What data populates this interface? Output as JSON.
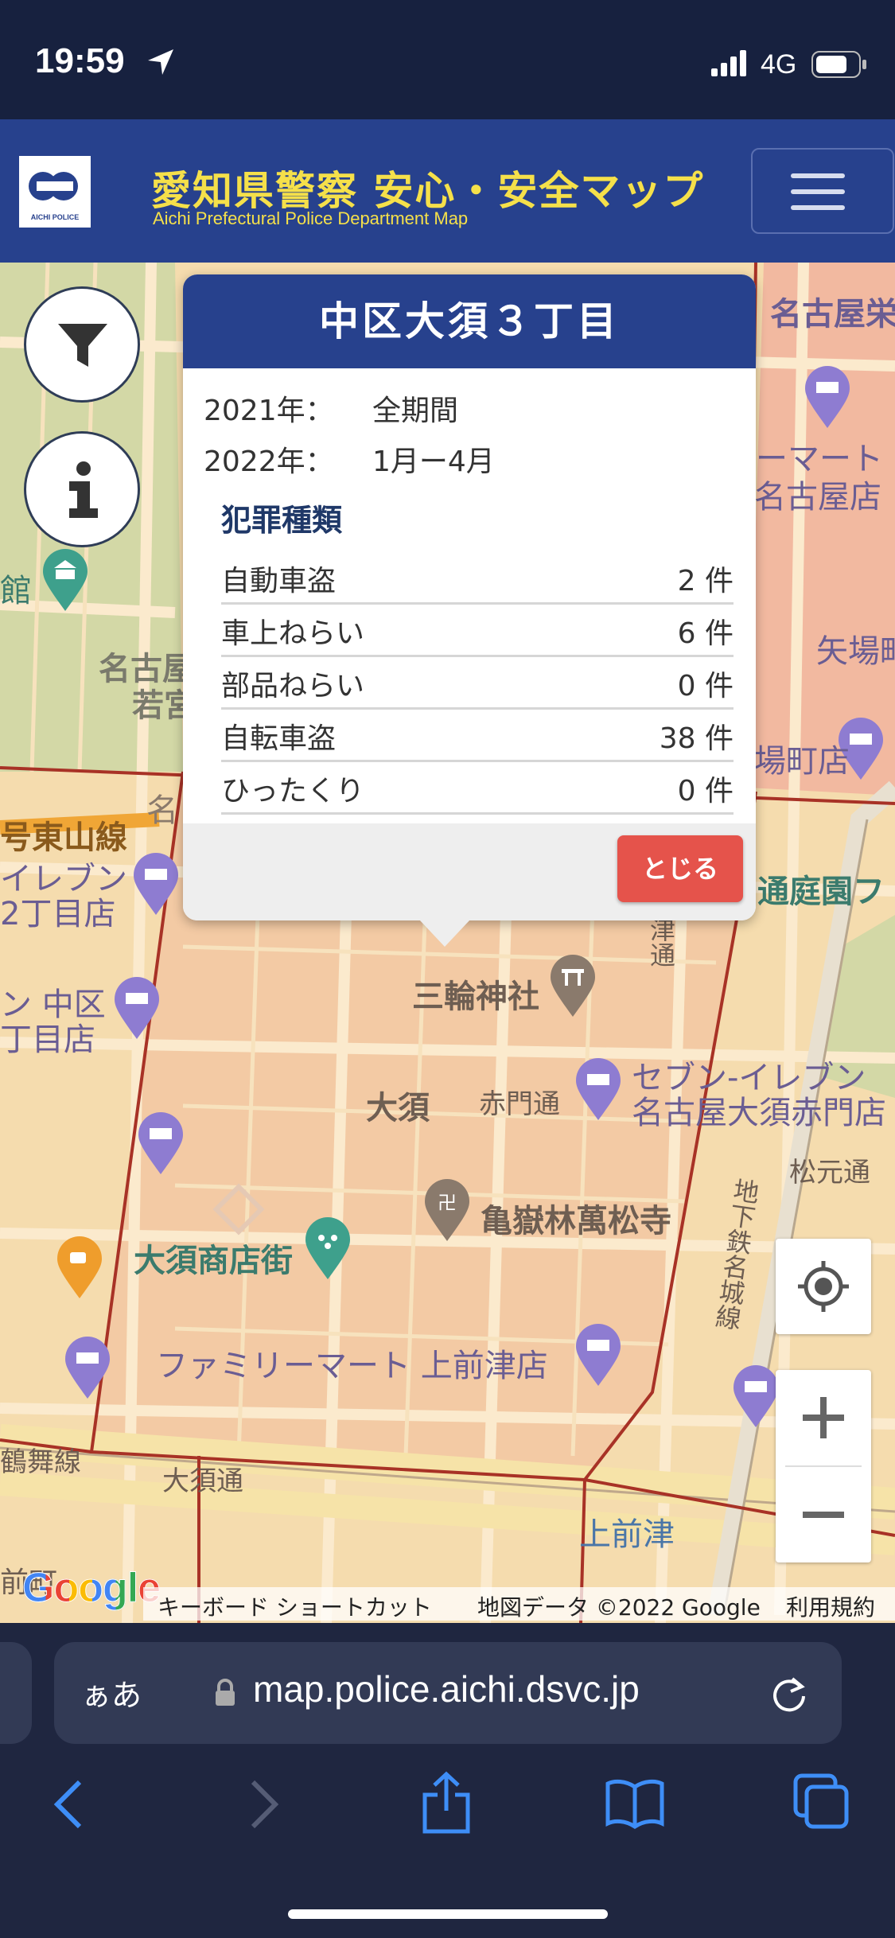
{
  "status_bar": {
    "time": "19:59",
    "network": "4G"
  },
  "header": {
    "title": "愛知県警察 安心・安全マップ",
    "subtitle": "Aichi Prefectural Police Department Map",
    "logo_text": "AICHI POLICE"
  },
  "map_labels": {
    "meitetsu": "名古屋栄",
    "mart1": "ーマート",
    "mart2": "名古屋店",
    "yaba": "矢場町",
    "yaba_store": "場町店",
    "museum": "館",
    "wakamiya1": "名古屋",
    "wakamiya2": "若宮",
    "higashiyama": "号東山線",
    "na": "名",
    "eleven1": "イレブン",
    "eleven2": "2丁目店",
    "naka1": "ン 中区",
    "naka2": "丁目店",
    "tsuuengai": "通庭園フ",
    "miwa": "三輪神社",
    "osu": "大須",
    "akamon": "赤門通",
    "seven1": "セブン-イレブン",
    "seven2": "名古屋大須赤門店",
    "otsu": "大津通",
    "matsubara": "松元通",
    "kokurin": "亀嶽林萬松寺",
    "osu_shotengai": "大須商店街",
    "famima": "ファミリーマート 上前津店",
    "subway": "地下鉄名城線",
    "tsurumai": "鶴舞線",
    "osudori": "大須通",
    "kamimaezu": "上前津",
    "maecho": "前町"
  },
  "popup": {
    "title": "中区大須３丁目",
    "periods": [
      {
        "label": "2021年：",
        "value": "全期間"
      },
      {
        "label": "2022年：",
        "value": "1月ー4月"
      }
    ],
    "crime_header": "犯罪種類",
    "crimes": [
      {
        "name": "自動車盗",
        "count": "2 件"
      },
      {
        "name": "車上ねらい",
        "count": "6 件"
      },
      {
        "name": "部品ねらい",
        "count": "0 件"
      },
      {
        "name": "自転車盗",
        "count": "38 件"
      },
      {
        "name": "ひったくり",
        "count": "0 件"
      }
    ],
    "close_label": "とじる"
  },
  "attribution": {
    "keyboard": "キーボード ショートカット",
    "data": "地図データ ©2022 Google",
    "terms": "利用規約",
    "google": "Google"
  },
  "browser": {
    "text_size": "ぁあ",
    "url": "map.police.aichi.dsvc.jp"
  },
  "colors": {
    "header_bg": "#27418d",
    "title_yellow": "#f5e04a",
    "close_red": "#e5534b",
    "map_red_zone": "#f2b9a0",
    "boundary": "#a83226"
  }
}
